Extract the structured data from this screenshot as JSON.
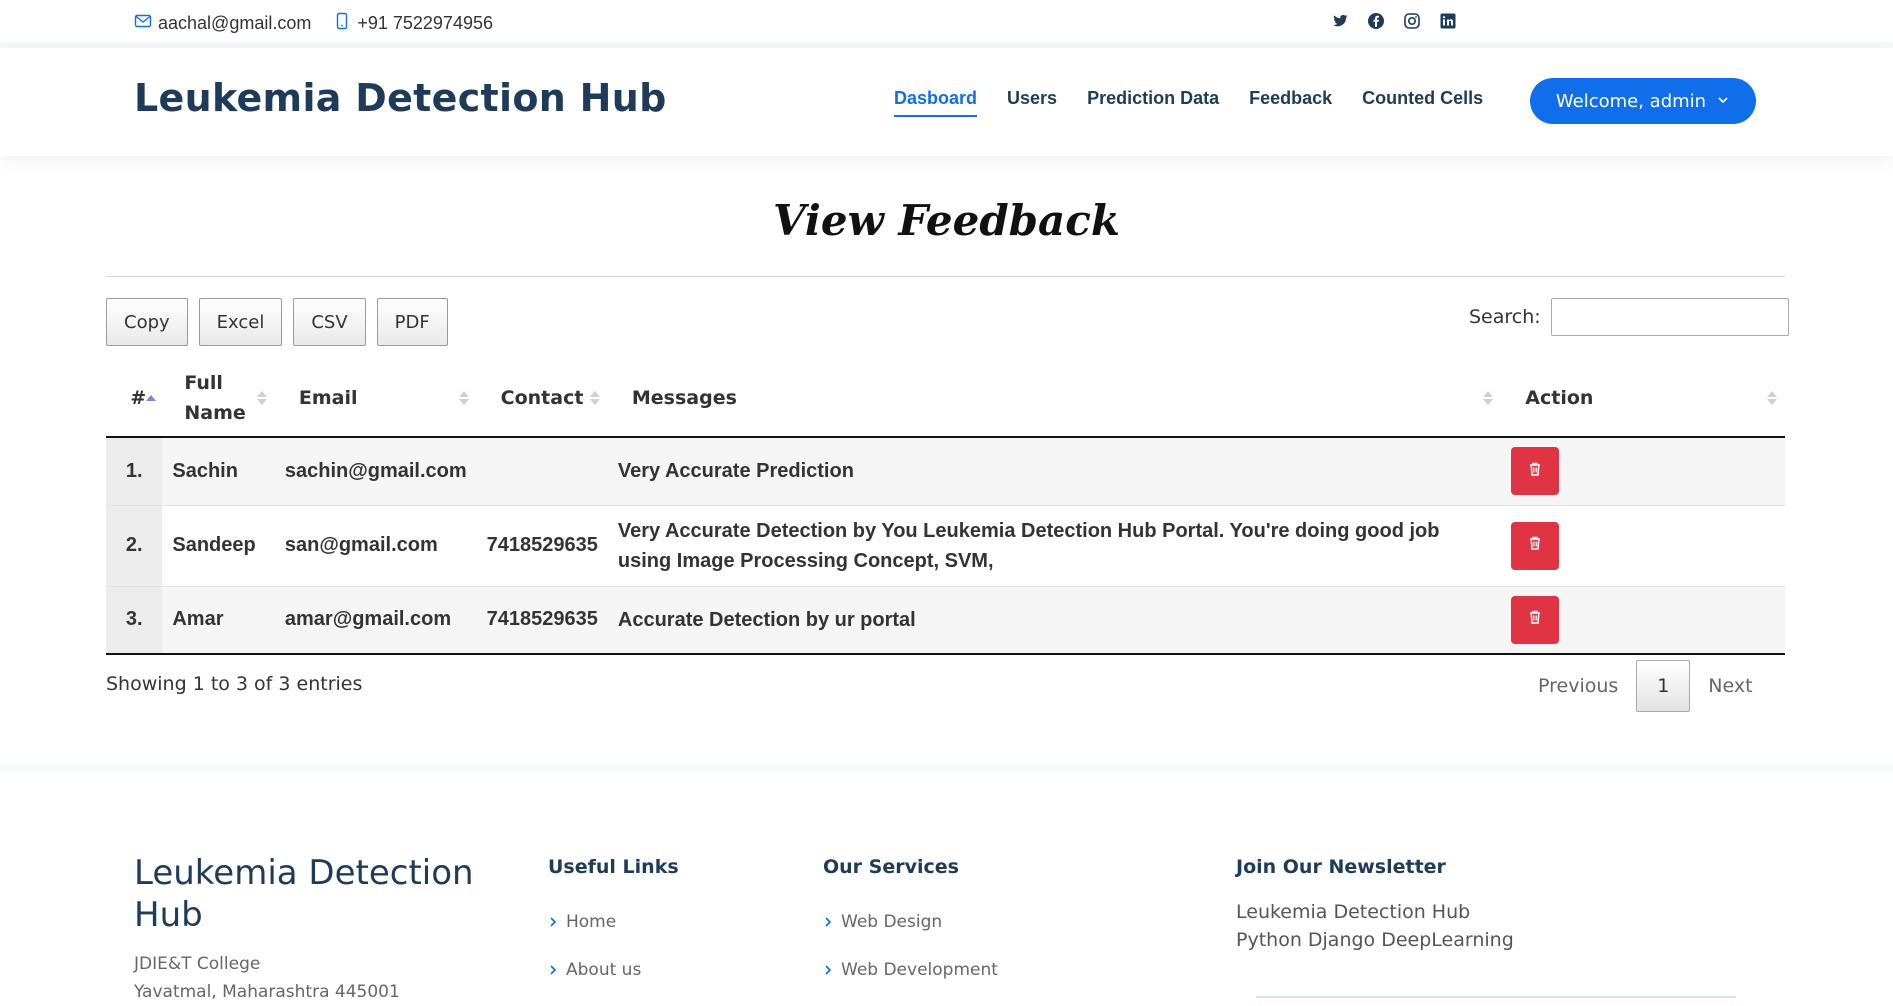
{
  "topbar": {
    "email": "aachal@gmail.com",
    "phone": "+91 7522974956",
    "social_icons": [
      "twitter-icon",
      "facebook-icon",
      "instagram-icon",
      "linkedin-icon"
    ]
  },
  "header": {
    "brand": "Leukemia Detection Hub",
    "nav": [
      "Dasboard",
      "Users",
      "Prediction Data",
      "Feedback",
      "Counted Cells"
    ],
    "active_nav": "Dasboard",
    "welcome_label": "Welcome, admin"
  },
  "main": {
    "title": "View Feedback",
    "export_buttons": [
      "Copy",
      "Excel",
      "CSV",
      "PDF"
    ],
    "search_label": "Search:",
    "search_value": "",
    "columns": [
      "#",
      "Full Name",
      "Email",
      "Contact",
      "Messages",
      "Action"
    ],
    "rows": [
      {
        "num": "1.",
        "name": "Sachin",
        "email": "sachin@gmail.com",
        "contact": "",
        "message": "Very Accurate Prediction"
      },
      {
        "num": "2.",
        "name": "Sandeep",
        "email": "san@gmail.com",
        "contact": "7418529635",
        "message": "Very Accurate Detection by You Leukemia Detection Hub Portal. You're doing good job using Image Processing Concept, SVM,"
      },
      {
        "num": "3.",
        "name": "Amar",
        "email": "amar@gmail.com",
        "contact": "7418529635",
        "message": "Accurate Detection by ur portal"
      }
    ],
    "info": "Showing 1 to 3 of 3 entries",
    "pager": {
      "prev": "Previous",
      "current": "1",
      "next": "Next"
    }
  },
  "footer": {
    "brand": "Leukemia Detection Hub",
    "address_line1": "JDIE&T College",
    "address_line2": "Yavatmal, Maharashtra 445001",
    "useful_links_title": "Useful Links",
    "useful_links": [
      "Home",
      "About us"
    ],
    "services_title": "Our Services",
    "services": [
      "Web Design",
      "Web Development"
    ],
    "newsletter_title": "Join Our Newsletter",
    "newsletter_line1": "Leukemia Detection Hub",
    "newsletter_line2": "Python Django DeepLearning"
  },
  "colors": {
    "primary": "#106eea",
    "brand_text": "#1f3b5a",
    "delete_button": "#e03444"
  }
}
